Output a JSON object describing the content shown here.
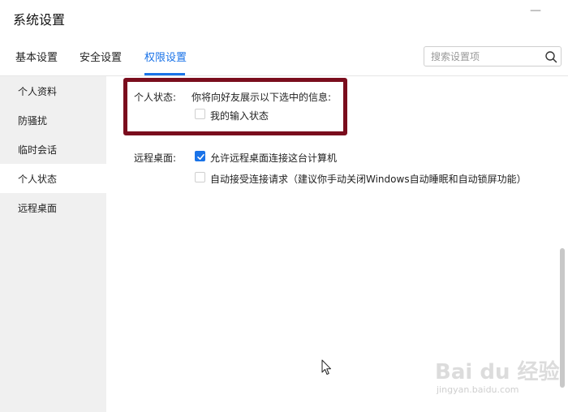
{
  "window": {
    "title": "系统设置",
    "close_glyph": "—"
  },
  "tabs": [
    {
      "label": "基本设置",
      "active": false
    },
    {
      "label": "安全设置",
      "active": false
    },
    {
      "label": "权限设置",
      "active": true
    }
  ],
  "search": {
    "placeholder": "搜索设置项",
    "value": ""
  },
  "sidebar": {
    "items": [
      {
        "label": "个人资料",
        "active": false
      },
      {
        "label": "防骚扰",
        "active": false
      },
      {
        "label": "临时会话",
        "active": false
      },
      {
        "label": "个人状态",
        "active": true
      },
      {
        "label": "远程桌面",
        "active": false
      }
    ]
  },
  "personal_status": {
    "label": "个人状态:",
    "description": "你将向好友展示以下选中的信息:",
    "options": [
      {
        "label": "我的输入状态",
        "checked": false
      }
    ]
  },
  "remote_desktop": {
    "label": "远程桌面:",
    "options": [
      {
        "label": "允许远程桌面连接这台计算机",
        "checked": true
      },
      {
        "label": "自动接受连接请求（建议你手动关闭Windows自动睡眠和自动锁屏功能）",
        "checked": false
      }
    ]
  },
  "watermark": {
    "logo_text": "Bai du 经验",
    "url": "jingyan.baidu.com"
  },
  "colors": {
    "accent": "#1a73e8",
    "highlight_border": "#7a0d1d",
    "sidebar_bg": "#f0f0f0"
  },
  "icons": {
    "search": "search-icon",
    "close": "minimize-icon",
    "checkmark": "check-icon",
    "cursor": "mouse-cursor-icon"
  }
}
